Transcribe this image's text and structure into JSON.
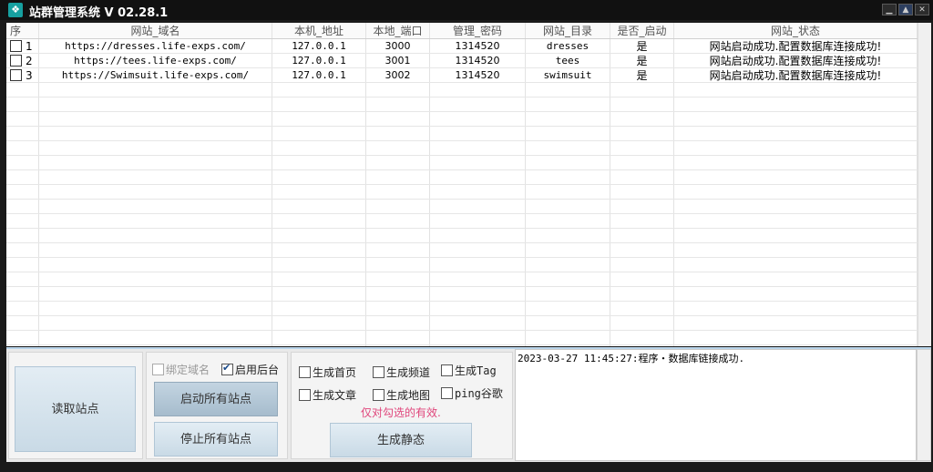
{
  "window": {
    "title": "站群管理系统 V 02.28.1",
    "icon": "app-icon",
    "accent": "#16a0a0"
  },
  "table": {
    "columns": [
      "序",
      "网站_域名",
      "本机_地址",
      "本地_端口",
      "管理_密码",
      "网站_目录",
      "是否_启动",
      "网站_状态"
    ],
    "rows": [
      {
        "seq": "1",
        "domain": "https://dresses.life-exps.com/",
        "ip": "127.0.0.1",
        "port": "3000",
        "password": "1314520",
        "dir": "dresses",
        "enabled": "是",
        "status": "网站启动成功.配置数据库连接成功!"
      },
      {
        "seq": "2",
        "domain": "https://tees.life-exps.com/",
        "ip": "127.0.0.1",
        "port": "3001",
        "password": "1314520",
        "dir": "tees",
        "enabled": "是",
        "status": "网站启动成功.配置数据库连接成功!"
      },
      {
        "seq": "3",
        "domain": "https://Swimsuit.life-exps.com/",
        "ip": "127.0.0.1",
        "port": "3002",
        "password": "1314520",
        "dir": "swimsuit",
        "enabled": "是",
        "status": "网站启动成功.配置数据库连接成功!"
      }
    ]
  },
  "controls": {
    "read_sites": "读取站点",
    "bind_domain": "绑定域名",
    "enable_backend": "启用后台",
    "start_all": "启动所有站点",
    "stop_all": "停止所有站点",
    "gen_home": "生成首页",
    "gen_channel": "生成频道",
    "gen_tag": "生成Tag",
    "gen_article": "生成文章",
    "gen_sitemap": "生成地图",
    "ping_google": "ping谷歌",
    "checked_only_note": "仅对勾选的有效.",
    "gen_static": "生成静态"
  },
  "log": {
    "lines": [
      "2023-03-27 11:45:27:程序・数据库链接成功."
    ]
  }
}
